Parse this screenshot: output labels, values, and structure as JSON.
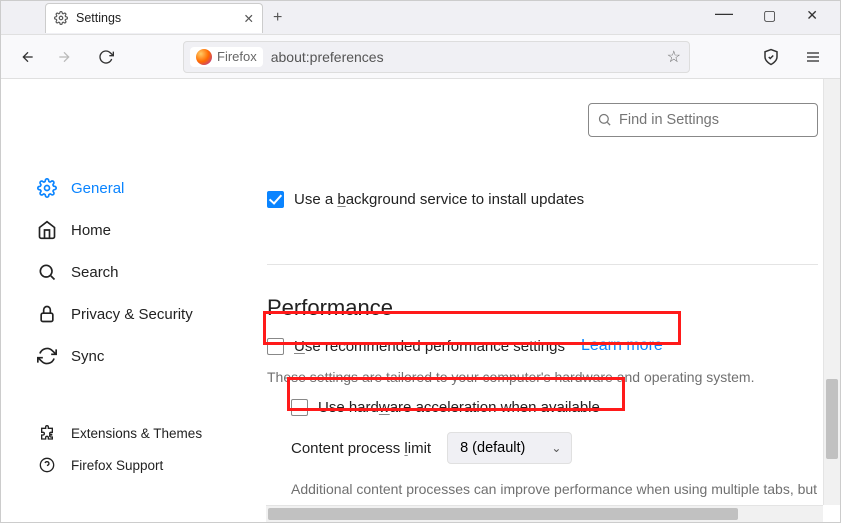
{
  "tab": {
    "title": "Settings"
  },
  "url": {
    "badge": "Firefox",
    "address": "about:preferences"
  },
  "search": {
    "placeholder": "Find in Settings"
  },
  "sidebar": {
    "general": "General",
    "home": "Home",
    "search": "Search",
    "privacy": "Privacy & Security",
    "sync": "Sync",
    "extensions": "Extensions & Themes",
    "support": "Firefox Support"
  },
  "updates": {
    "bg_service_label": "Use a background service to install updates"
  },
  "performance": {
    "heading": "Performance",
    "recommended_label": "Use recommended performance settings",
    "learn_more": "Learn more",
    "tailored_note": "These settings are tailored to your computer's hardware and operating system.",
    "hw_accel_label": "Use hardware acceleration when available",
    "content_limit_label": "Content process limit",
    "content_limit_value": "8 (default)",
    "additional_note": "Additional content processes can improve performance when using multiple tabs, but will also use more memory."
  }
}
